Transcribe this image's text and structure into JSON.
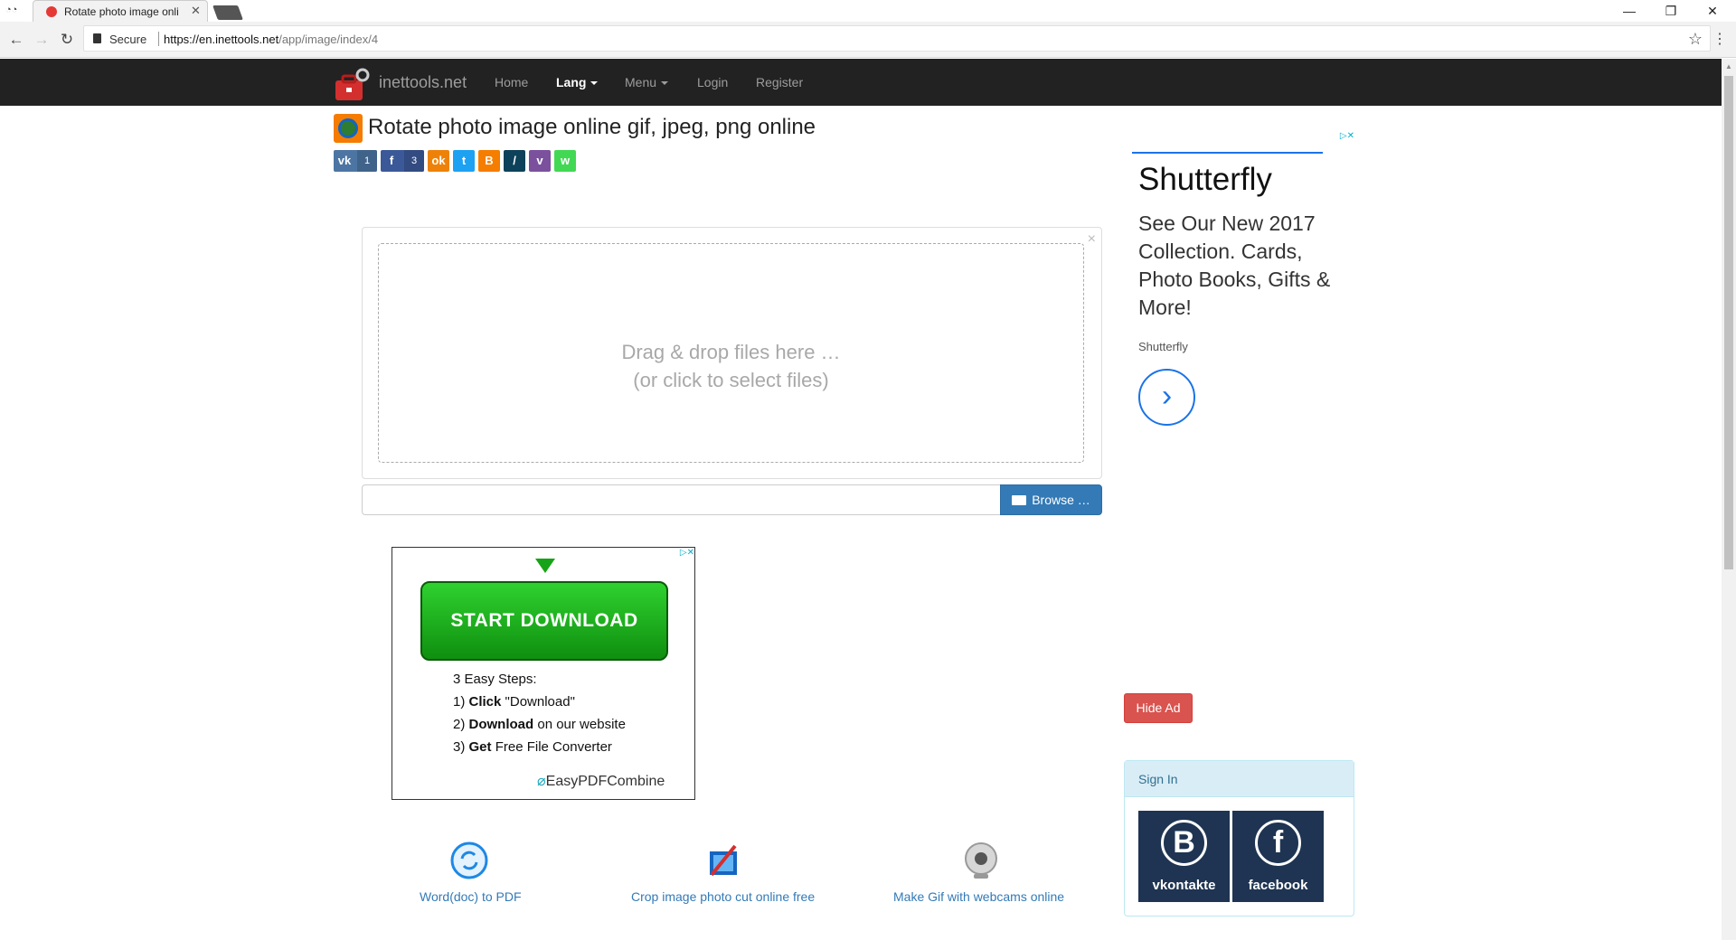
{
  "browser": {
    "tab_title": "Rotate photo image onli",
    "secure_label": "Secure",
    "url_host": "https://en.inettools.net",
    "url_path": "/app/image/index/4"
  },
  "site": {
    "logo_text": "inettools.net",
    "nav": [
      {
        "label": "Home"
      },
      {
        "label": "Lang",
        "active": true
      },
      {
        "label": "Menu"
      },
      {
        "label": "Login"
      },
      {
        "label": "Register"
      }
    ]
  },
  "page": {
    "title": "Rotate photo image online gif, jpeg, png online",
    "share_buttons": [
      {
        "icon": "vk-icon",
        "glyph": "vk",
        "count": "1",
        "color": "#4c75a3"
      },
      {
        "icon": "facebook-icon",
        "glyph": "f",
        "count": "3",
        "color": "#3b5998"
      },
      {
        "icon": "odnoklassniki-icon",
        "glyph": "ok",
        "color": "#ee8208"
      },
      {
        "icon": "twitter-icon",
        "glyph": "t",
        "color": "#1da1f2"
      },
      {
        "icon": "blogger-icon",
        "glyph": "B",
        "color": "#f57d00"
      },
      {
        "icon": "livejournal-icon",
        "glyph": "/",
        "color": "#0d425a"
      },
      {
        "icon": "viber-icon",
        "glyph": "v",
        "color": "#7b519d"
      },
      {
        "icon": "whatsapp-icon",
        "glyph": "w",
        "color": "#43d854"
      }
    ]
  },
  "upload": {
    "dropzone_line1": "Drag & drop files here …",
    "dropzone_line2": "(or click to select files)",
    "browse_label": "Browse …"
  },
  "ad": {
    "button_label": "START DOWNLOAD",
    "steps_title": "3 Easy Steps:",
    "step1_num": "1)",
    "step1_bold": "Click",
    "step1_rest": "\"Download\"",
    "step2_num": "2)",
    "step2_bold": "Download",
    "step2_rest": "on our website",
    "step3_num": "3)",
    "step3_bold": "Get",
    "step3_rest": "Free File Converter",
    "brand_easy": "EasyPDFCombine"
  },
  "tools": [
    {
      "label": "Word(doc) to PDF",
      "icon": "word-to-pdf-icon"
    },
    {
      "label": "Crop image photo cut online free",
      "icon": "crop-image-icon"
    },
    {
      "label": "Make Gif with webcams online",
      "icon": "webcam-icon"
    }
  ],
  "side_ad": {
    "title": "Shutterfly",
    "description": "See Our New 2017 Collection. Cards, Photo Books, Gifts & More!",
    "source": "Shutterfly",
    "arrow": "›"
  },
  "hide_ad_label": "Hide Ad",
  "signin": {
    "title": "Sign In",
    "vk_glyph": "B",
    "vk_label": "vkontakte",
    "fb_glyph": "f",
    "fb_label": "facebook"
  },
  "colors": {
    "navbar": "#222222",
    "link": "#337ab7",
    "primary": "#337ab7",
    "danger": "#d9534f"
  }
}
